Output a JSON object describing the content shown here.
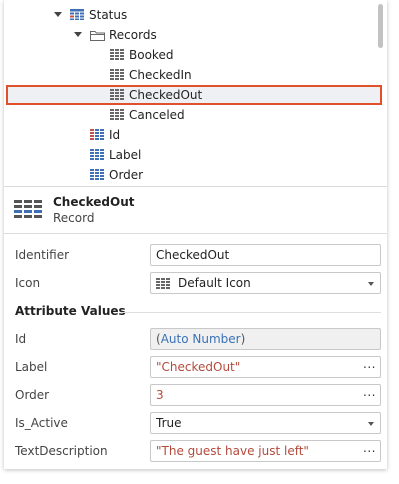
{
  "tree": {
    "status": "Status",
    "records": "Records",
    "booked": "Booked",
    "checked_in": "CheckedIn",
    "checked_out": "CheckedOut",
    "canceled": "Canceled",
    "id": "Id",
    "label": "Label",
    "order": "Order"
  },
  "header": {
    "title": "CheckedOut",
    "subtitle": "Record"
  },
  "properties": {
    "identifier_label": "Identifier",
    "identifier_value": "CheckedOut",
    "icon_label": "Icon",
    "icon_value": "Default Icon",
    "section_title": "Attribute Values",
    "id_label": "Id",
    "id_value_open": "(",
    "id_value_text": "Auto Number",
    "id_value_close": ")",
    "label_label": "Label",
    "label_value": "\"CheckedOut\"",
    "order_label": "Order",
    "order_value": "3",
    "is_active_label": "Is_Active",
    "is_active_value": "True",
    "textdesc_label": "TextDescription",
    "textdesc_value": "\"The guest have just left\"",
    "ellipsis": "..."
  },
  "colors": {
    "selection_border": "#e0512a",
    "string_value": "#b34a3c",
    "auto_number": "#3a72b5",
    "entity_icon": "#3f6fb5",
    "folder_icon": "#666666"
  },
  "icons": {
    "entity": "entity-grid-icon",
    "folder": "folder-icon",
    "record": "record-grid-icon",
    "attribute": "attribute-grid-icon",
    "identifier_attribute": "identifier-attribute-icon"
  }
}
